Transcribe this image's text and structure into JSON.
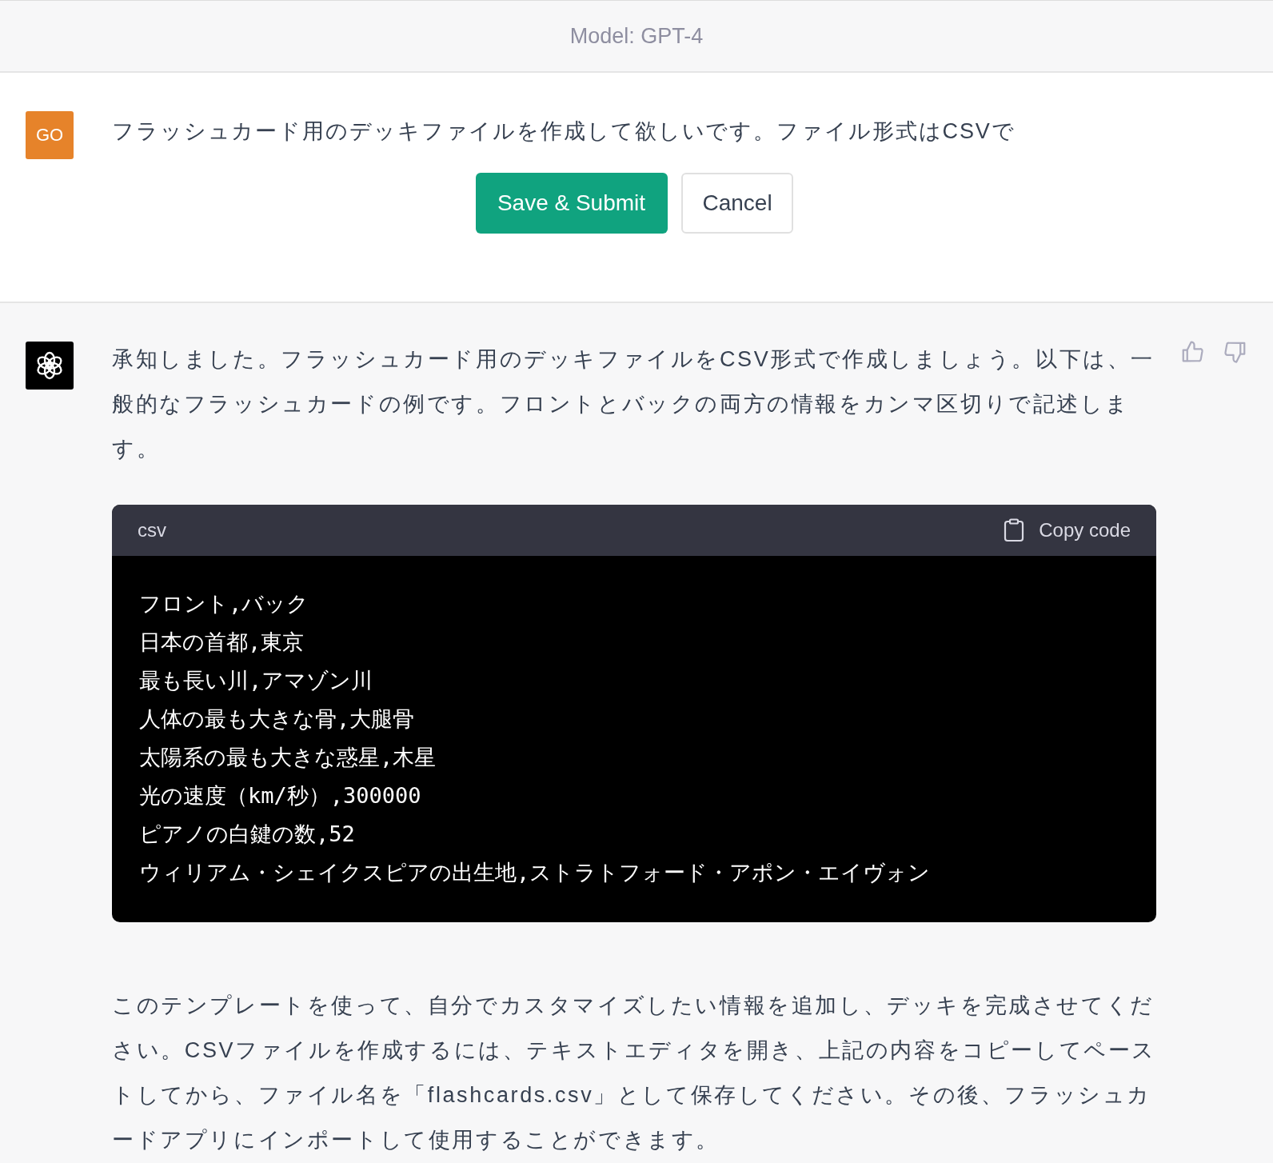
{
  "header": {
    "title": "Model: GPT-4"
  },
  "user_message": {
    "avatar": "GO",
    "text": "フラッシュカード用のデッキファイルを作成して欲しいです。ファイル形式はCSVで",
    "buttons": [
      {
        "label": "Save & Submit",
        "kind": "primary"
      },
      {
        "label": "Cancel",
        "kind": "secondary"
      }
    ]
  },
  "assistant_message": {
    "intro": "承知しました。フラッシュカード用のデッキファイルをCSV形式で作成しましょう。以下は、一般的なフラッシュカードの例です。フロントとバックの両方の情報をカンマ区切りで記述します。",
    "code_block": {
      "language": "csv",
      "copy_label": "Copy code",
      "lines": [
        "フロント,バック",
        "日本の首都,東京",
        "最も長い川,アマゾン川",
        "人体の最も大きな骨,大腿骨",
        "太陽系の最も大きな惑星,木星",
        "光の速度（km/秒）,300000",
        "ピアノの白鍵の数,52",
        "ウィリアム・シェイクスピアの出生地,ストラトフォード・アポン・エイヴォン"
      ]
    },
    "outro": "このテンプレートを使って、自分でカスタマイズしたい情報を追加し、デッキを完成させてください。CSVファイルを作成するには、テキストエディタを開き、上記の内容をコピーしてペーストしてから、ファイル名を「flashcards.csv」として保存してください。その後、フラッシュカードアプリにインポートして使用することができます。"
  }
}
